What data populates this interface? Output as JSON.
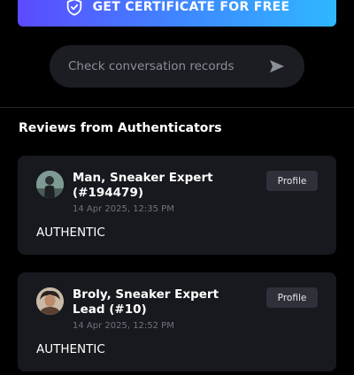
{
  "cta": {
    "label": "GET CERTIFICATE FOR FREE",
    "icon": "shield-check-icon"
  },
  "records": {
    "label": "Check conversation records",
    "icon": "send-icon"
  },
  "section": {
    "title": "Reviews from Authenticators"
  },
  "reviews": [
    {
      "name": "Man, Sneaker Expert (#194479)",
      "time": "14 Apr 2025, 12:35 PM",
      "profile_label": "Profile",
      "verdict": "AUTHENTIC"
    },
    {
      "name": "Broly, Sneaker Expert Lead (#10)",
      "time": "14 Apr 2025, 12:52 PM",
      "profile_label": "Profile",
      "verdict": "AUTHENTIC"
    }
  ],
  "colors": {
    "background": "#000000",
    "card": "#17191e",
    "cta_gradient_start": "#5b4bff",
    "cta_gradient_end": "#2fb7ff",
    "muted_text": "#8b8f98"
  }
}
